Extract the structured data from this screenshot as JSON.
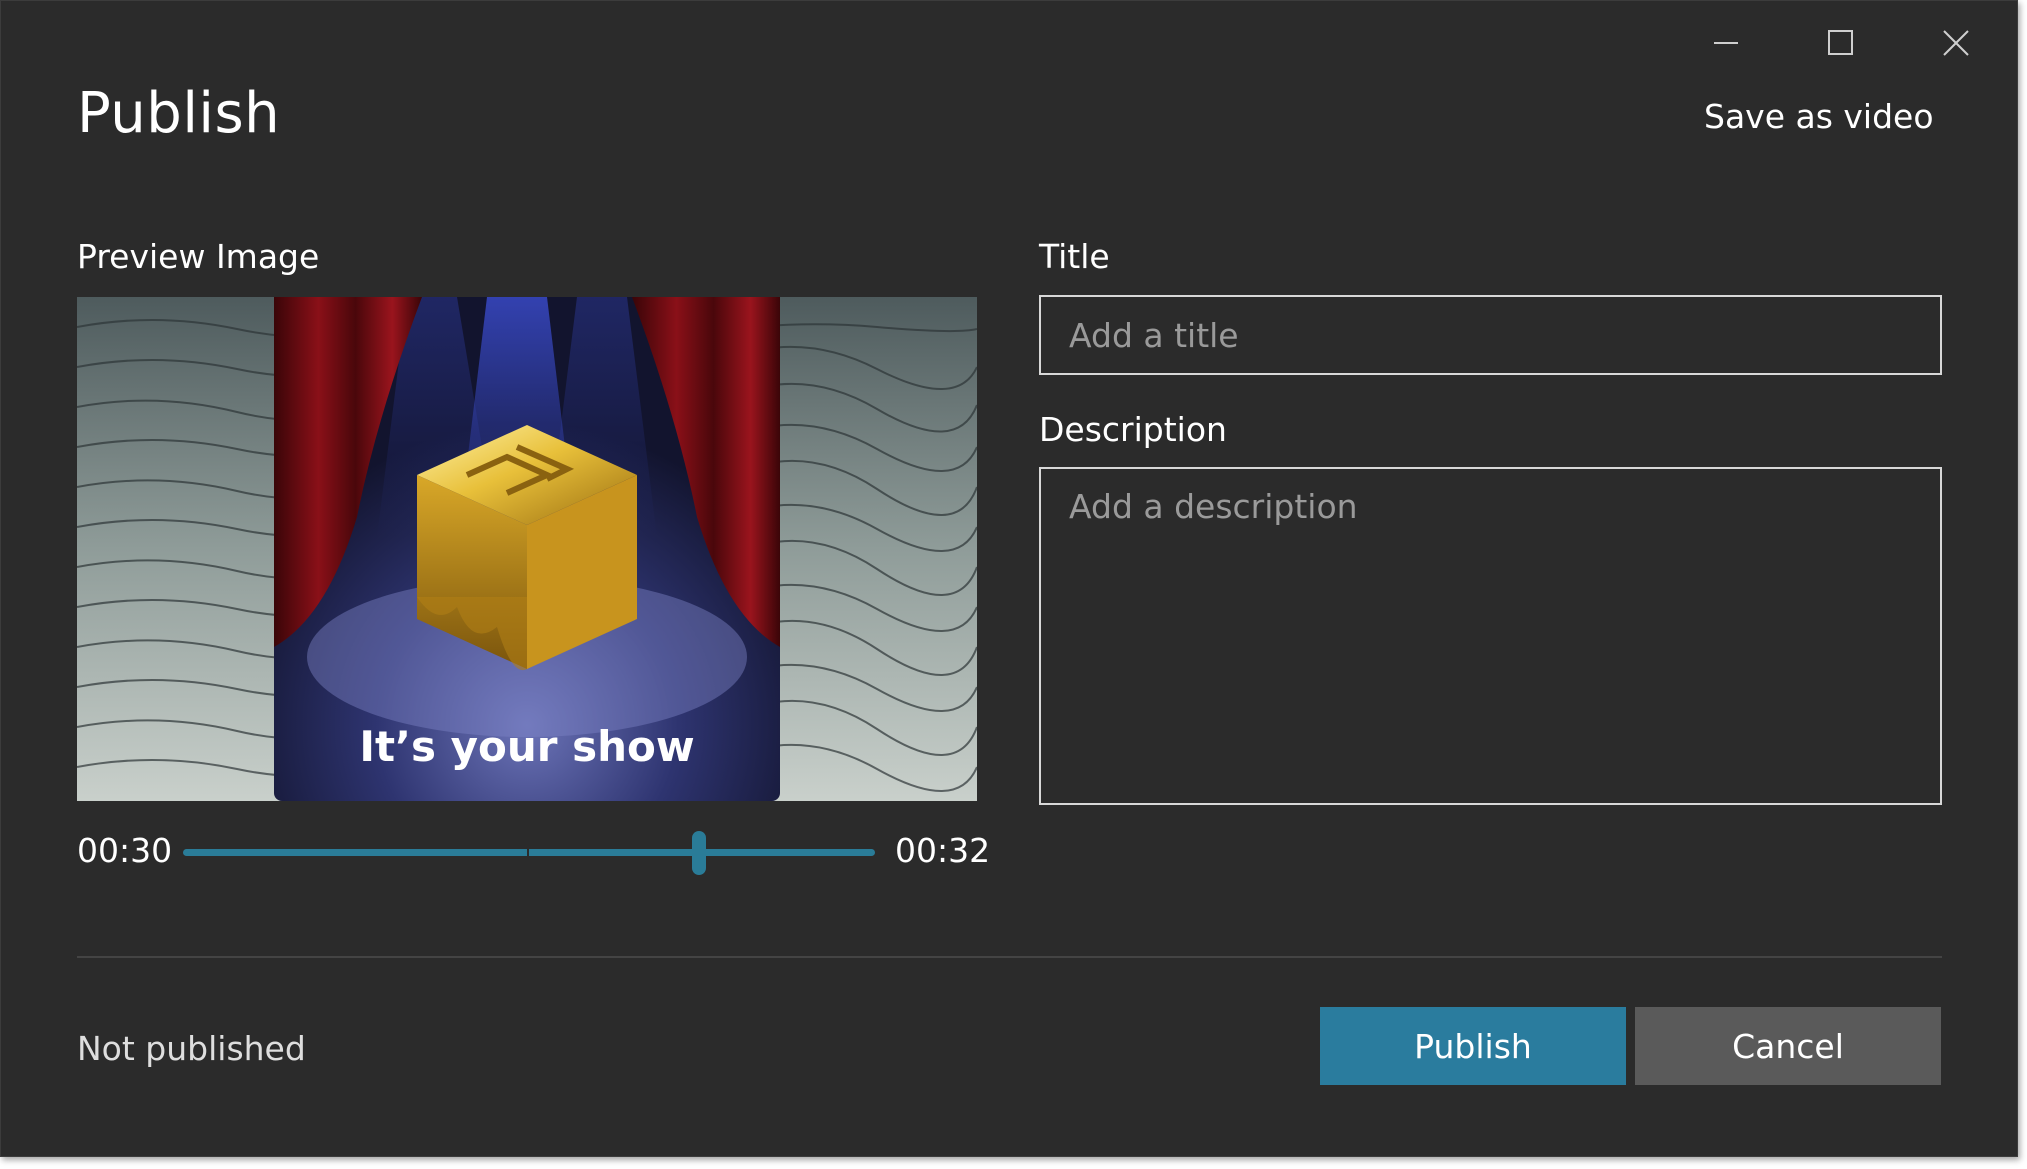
{
  "window": {
    "controls": {
      "minimize_icon": "minimize-icon",
      "maximize_icon": "maximize-icon",
      "close_icon": "close-icon"
    }
  },
  "header": {
    "title": "Publish",
    "save_as_video": "Save as video"
  },
  "preview": {
    "label": "Preview Image",
    "image_caption": "It’s your show",
    "start_time": "00:30",
    "end_time": "00:32",
    "slider_position": 0.745
  },
  "form": {
    "title_label": "Title",
    "title_placeholder": "Add a title",
    "description_label": "Description",
    "description_placeholder": "Add a description"
  },
  "footer": {
    "status": "Not published",
    "publish_label": "Publish",
    "cancel_label": "Cancel"
  },
  "colors": {
    "background": "#2b2b2b",
    "accent": "#2a7c9e",
    "secondary_button": "#5a5a5a"
  }
}
